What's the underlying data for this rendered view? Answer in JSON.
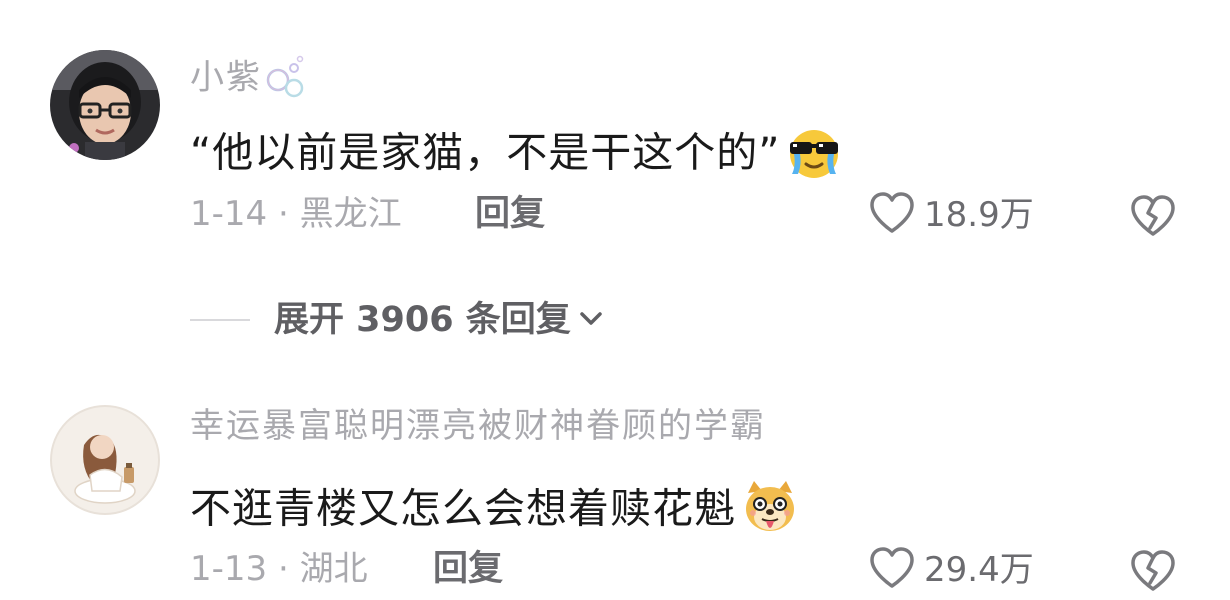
{
  "comments": [
    {
      "username": "小紫",
      "username_decoration_icon": "bubbles-icon",
      "text": "“他以前是家猫，不是干这个的”",
      "emoji_icon": "sunglasses-crying-emoji-icon",
      "date_location": "1-14 · 黑龙江",
      "reply_label": "回复",
      "likes": "18.9万"
    },
    {
      "username": "幸运暴富聪明漂亮被财神眷顾的学霸",
      "text": "不逛青楼又怎么会想着赎花魁",
      "emoji_icon": "doge-tongue-emoji-icon",
      "date_location": "1-13 · 湖北",
      "reply_label": "回复",
      "likes": "29.4万"
    }
  ],
  "expand_replies": {
    "label": "展开 3906 条回复"
  },
  "colors": {
    "username": "#a9a9ae",
    "content": "#1a1a1a",
    "meta": "#a9a9ae",
    "action": "#6b6b6f"
  }
}
